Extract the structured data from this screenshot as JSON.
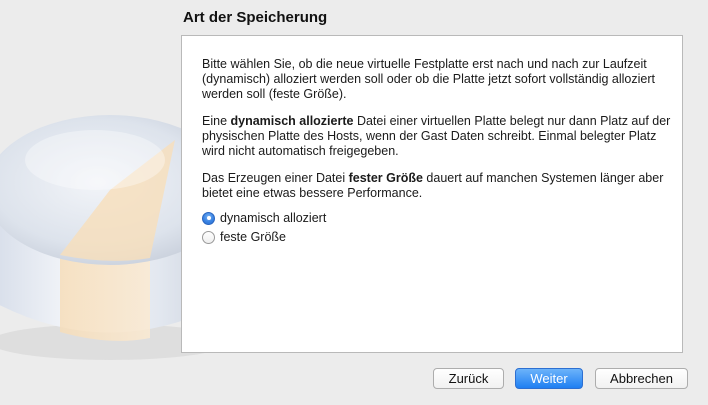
{
  "page": {
    "title": "Art der Speicherung"
  },
  "content": {
    "para1": "Bitte wählen Sie, ob die neue virtuelle Festplatte erst nach und nach zur Laufzeit (dynamisch) alloziert werden soll oder ob die Platte jetzt sofort vollständig alloziert werden soll (feste Größe).",
    "para2_prefix": "Eine ",
    "para2_bold": "dynamisch allozierte",
    "para2_suffix": " Datei einer virtuellen Platte belegt nur dann Platz auf der physischen Platte des Hosts, wenn der Gast Daten schreibt. Einmal belegter Platz wird nicht automatisch freigegeben.",
    "para3_prefix": "Das Erzeugen einer Datei ",
    "para3_bold": "fester Größe",
    "para3_suffix": " dauert auf manchen Systemen länger aber bietet eine etwas bessere Performance."
  },
  "options": {
    "dynamic_label": "dynamisch alloziert",
    "fixed_label": "feste Größe",
    "selected": "dynamisch alloziert"
  },
  "buttons": {
    "back": "Zurück",
    "next": "Weiter",
    "cancel": "Abbrechen"
  },
  "colors": {
    "default_button": "#1f7ff2",
    "window_bg": "#ececec"
  },
  "icons": {
    "disk_illustration": "hard-disk-icon"
  }
}
